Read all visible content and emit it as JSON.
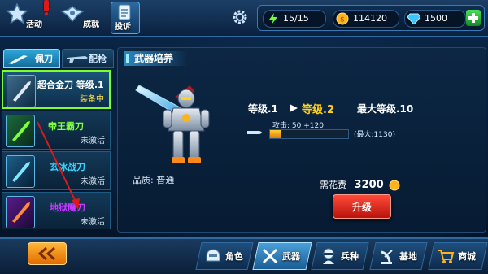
{
  "top": {
    "activity_label": "活动",
    "achievement_label": "成就",
    "complaint_label": "投诉",
    "stamina": "15/15",
    "gold": "114120",
    "diamonds": "1500"
  },
  "tabs": {
    "saber": "佩刀",
    "sidearm": "配枪"
  },
  "weapons": [
    {
      "name": "超合金刀 等级.1",
      "status": "装备中",
      "color": "#ffffff"
    },
    {
      "name": "帝王霸刀",
      "status": "未激活",
      "color": "#7dff3a"
    },
    {
      "name": "玄冰战刀",
      "status": "未激活",
      "color": "#3ad6ff"
    },
    {
      "name": "地狱魔刀",
      "status": "未激活",
      "color": "#c43aff"
    }
  ],
  "panel": {
    "title": "武器培养",
    "level_current": "等级.1",
    "level_next": "等级.2",
    "max_level": "最大等级.10",
    "attack_text": "攻击: 50 +120",
    "attack_max": "(最大:1130)",
    "attack_fill_fraction": 0.15,
    "quality": "品质: 普通",
    "cost_label": "需花费",
    "cost_value": "3200",
    "upgrade_label": "升级"
  },
  "nav": {
    "role": "角色",
    "weapon": "武器",
    "troops": "兵种",
    "base": "基地",
    "shop": "商城"
  },
  "colors": {
    "accent_green": "#7dff2a",
    "level_next": "#ffd21f",
    "upgrade": "#e0261a"
  }
}
